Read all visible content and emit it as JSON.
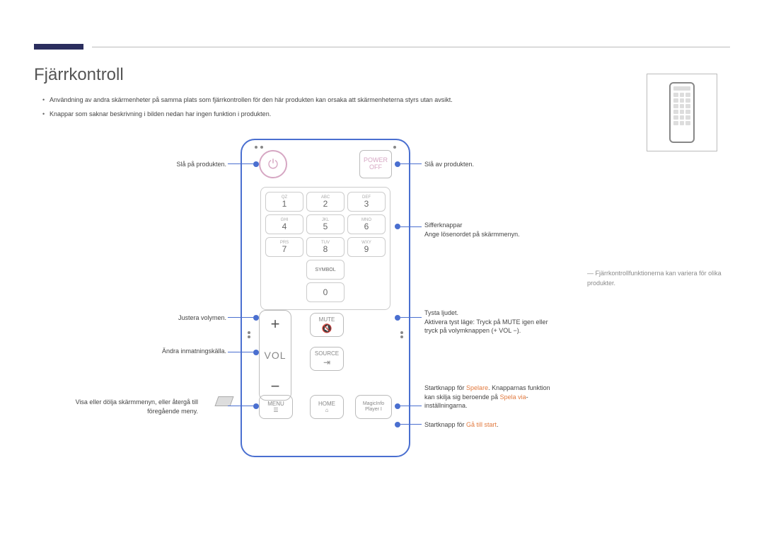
{
  "title": "Fjärrkontroll",
  "bullets": [
    "Användning av andra skärmenheter på samma plats som fjärrkontrollen för den här produkten kan orsaka att skärmenheterna styrs utan avsikt.",
    "Knappar som saknar beskrivning i bilden nedan har ingen funktion i produkten."
  ],
  "remote": {
    "power_off": {
      "line1": "POWER",
      "line2": "OFF"
    },
    "keys": {
      "1": {
        "sub": "QZ",
        "n": "1"
      },
      "2": {
        "sub": "ABC",
        "n": "2"
      },
      "3": {
        "sub": "DEF",
        "n": "3"
      },
      "4": {
        "sub": "GHI",
        "n": "4"
      },
      "5": {
        "sub": "JKL",
        "n": "5"
      },
      "6": {
        "sub": "MNO",
        "n": "6"
      },
      "7": {
        "sub": "PRS",
        "n": "7"
      },
      "8": {
        "sub": "TUV",
        "n": "8"
      },
      "9": {
        "sub": "WXY",
        "n": "9"
      },
      "symbol": "SYMBOL",
      "0": "0"
    },
    "vol": {
      "plus": "+",
      "label": "VOL",
      "minus": "−"
    },
    "mute": "MUTE",
    "source": "SOURCE",
    "menu": "MENU",
    "home": "HOME",
    "magic": {
      "l1": "MagicInfo",
      "l2": "Player I"
    }
  },
  "callouts": {
    "power_on": "Slå på produkten.",
    "power_off": "Slå av produkten.",
    "numbers": {
      "l1": "Sifferknappar",
      "l2": "Ange lösenordet på skärmmenyn."
    },
    "mute": {
      "l1": "Tysta ljudet.",
      "l2": "Aktivera tyst läge: Tryck på MUTE igen eller",
      "l3": "tryck på volymknappen (+ VOL −)."
    },
    "vol": "Justera volymen.",
    "source": "Ändra inmatningskälla.",
    "menu": {
      "l1": "Visa eller dölja skärmmenyn, eller återgå till",
      "l2": "föregående meny."
    },
    "magic": {
      "l1": "Startknapp för ",
      "orange1": "Spelare",
      "l1b": ". Knapparnas funktion",
      "l2": "kan skilja sig beroende på ",
      "orange2": "Spela via",
      "l2b": "-",
      "l3": "inställningarna."
    },
    "home": {
      "l1": "Startknapp för ",
      "orange": "Gå till start",
      "l1b": "."
    }
  },
  "note": "Fjärrkontrollfunktionerna kan variera för olika produkter."
}
